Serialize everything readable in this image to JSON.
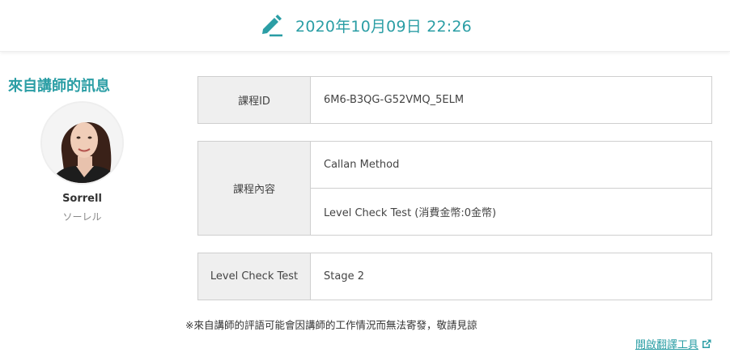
{
  "header": {
    "datetime": "2020年10月09日 22:26",
    "icon": "pencil-icon",
    "accent_color": "#2b9ea5"
  },
  "teacher": {
    "section_title": "來自講師的訊息",
    "name": "Sorrell",
    "name_kana": "ソーレル"
  },
  "lesson": {
    "id_label": "課程ID",
    "id_value": "6M6-B3QG-G52VMQ_5ELM",
    "content_label": "課程內容",
    "content_values": [
      "Callan Method",
      "Level Check Test (消費金幣:0金幣)"
    ],
    "level_label": "Level Check Test",
    "level_value": "Stage 2"
  },
  "footer": {
    "note": "※來自講師的評語可能會因講師的工作情況而無法寄發，敬請見諒",
    "translate_link": "開啟翻譯工具",
    "link_icon": "external-link-icon"
  }
}
